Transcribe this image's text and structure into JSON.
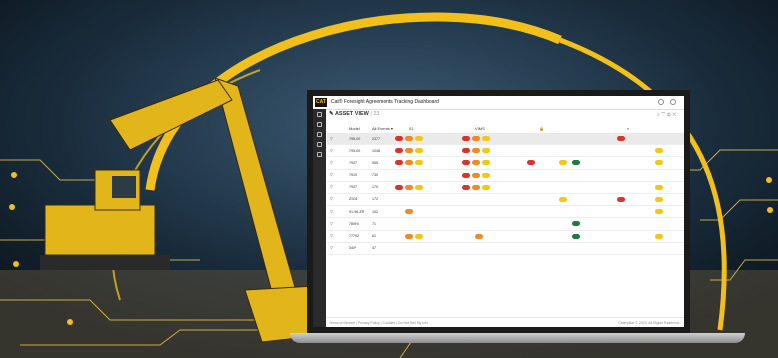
{
  "colors": {
    "accent": "#f7c600",
    "red": "#d9342b",
    "orange": "#f18a21",
    "yellow": "#f4c811",
    "green": "#1f7a3d"
  },
  "app": {
    "logo": "CAT",
    "title": "Cat® Foresight Agreements Tracking Dashboard"
  },
  "view": {
    "title": "ASSET VIEW",
    "count": "23"
  },
  "columns": {
    "model": "Model",
    "all_events": "All Events ▾",
    "group1": "01",
    "group2": "VIMS"
  },
  "rows": [
    {
      "model": "795-00",
      "count": "2377",
      "selected": true
    },
    {
      "model": "795-00",
      "count": "1046",
      "selected": false
    },
    {
      "model": "7937",
      "count": "955",
      "selected": false
    },
    {
      "model": "7919",
      "count": "730",
      "selected": false
    },
    {
      "model": "7937",
      "count": "170",
      "selected": false
    },
    {
      "model": "ZS01",
      "count": "172",
      "selected": false
    },
    {
      "model": "91-96-ZR",
      "count": "102",
      "selected": false
    },
    {
      "model": "780HI",
      "count": "71",
      "selected": false
    },
    {
      "model": "77792",
      "count": "61",
      "selected": false
    },
    {
      "model": "340*",
      "count": "47",
      "selected": false
    }
  ],
  "footer": {
    "left": "Terms of Service | Privacy Policy | Cookies | Do Not Sell My Info",
    "right": "Caterpillar © 2023. All Rights Reserved."
  }
}
